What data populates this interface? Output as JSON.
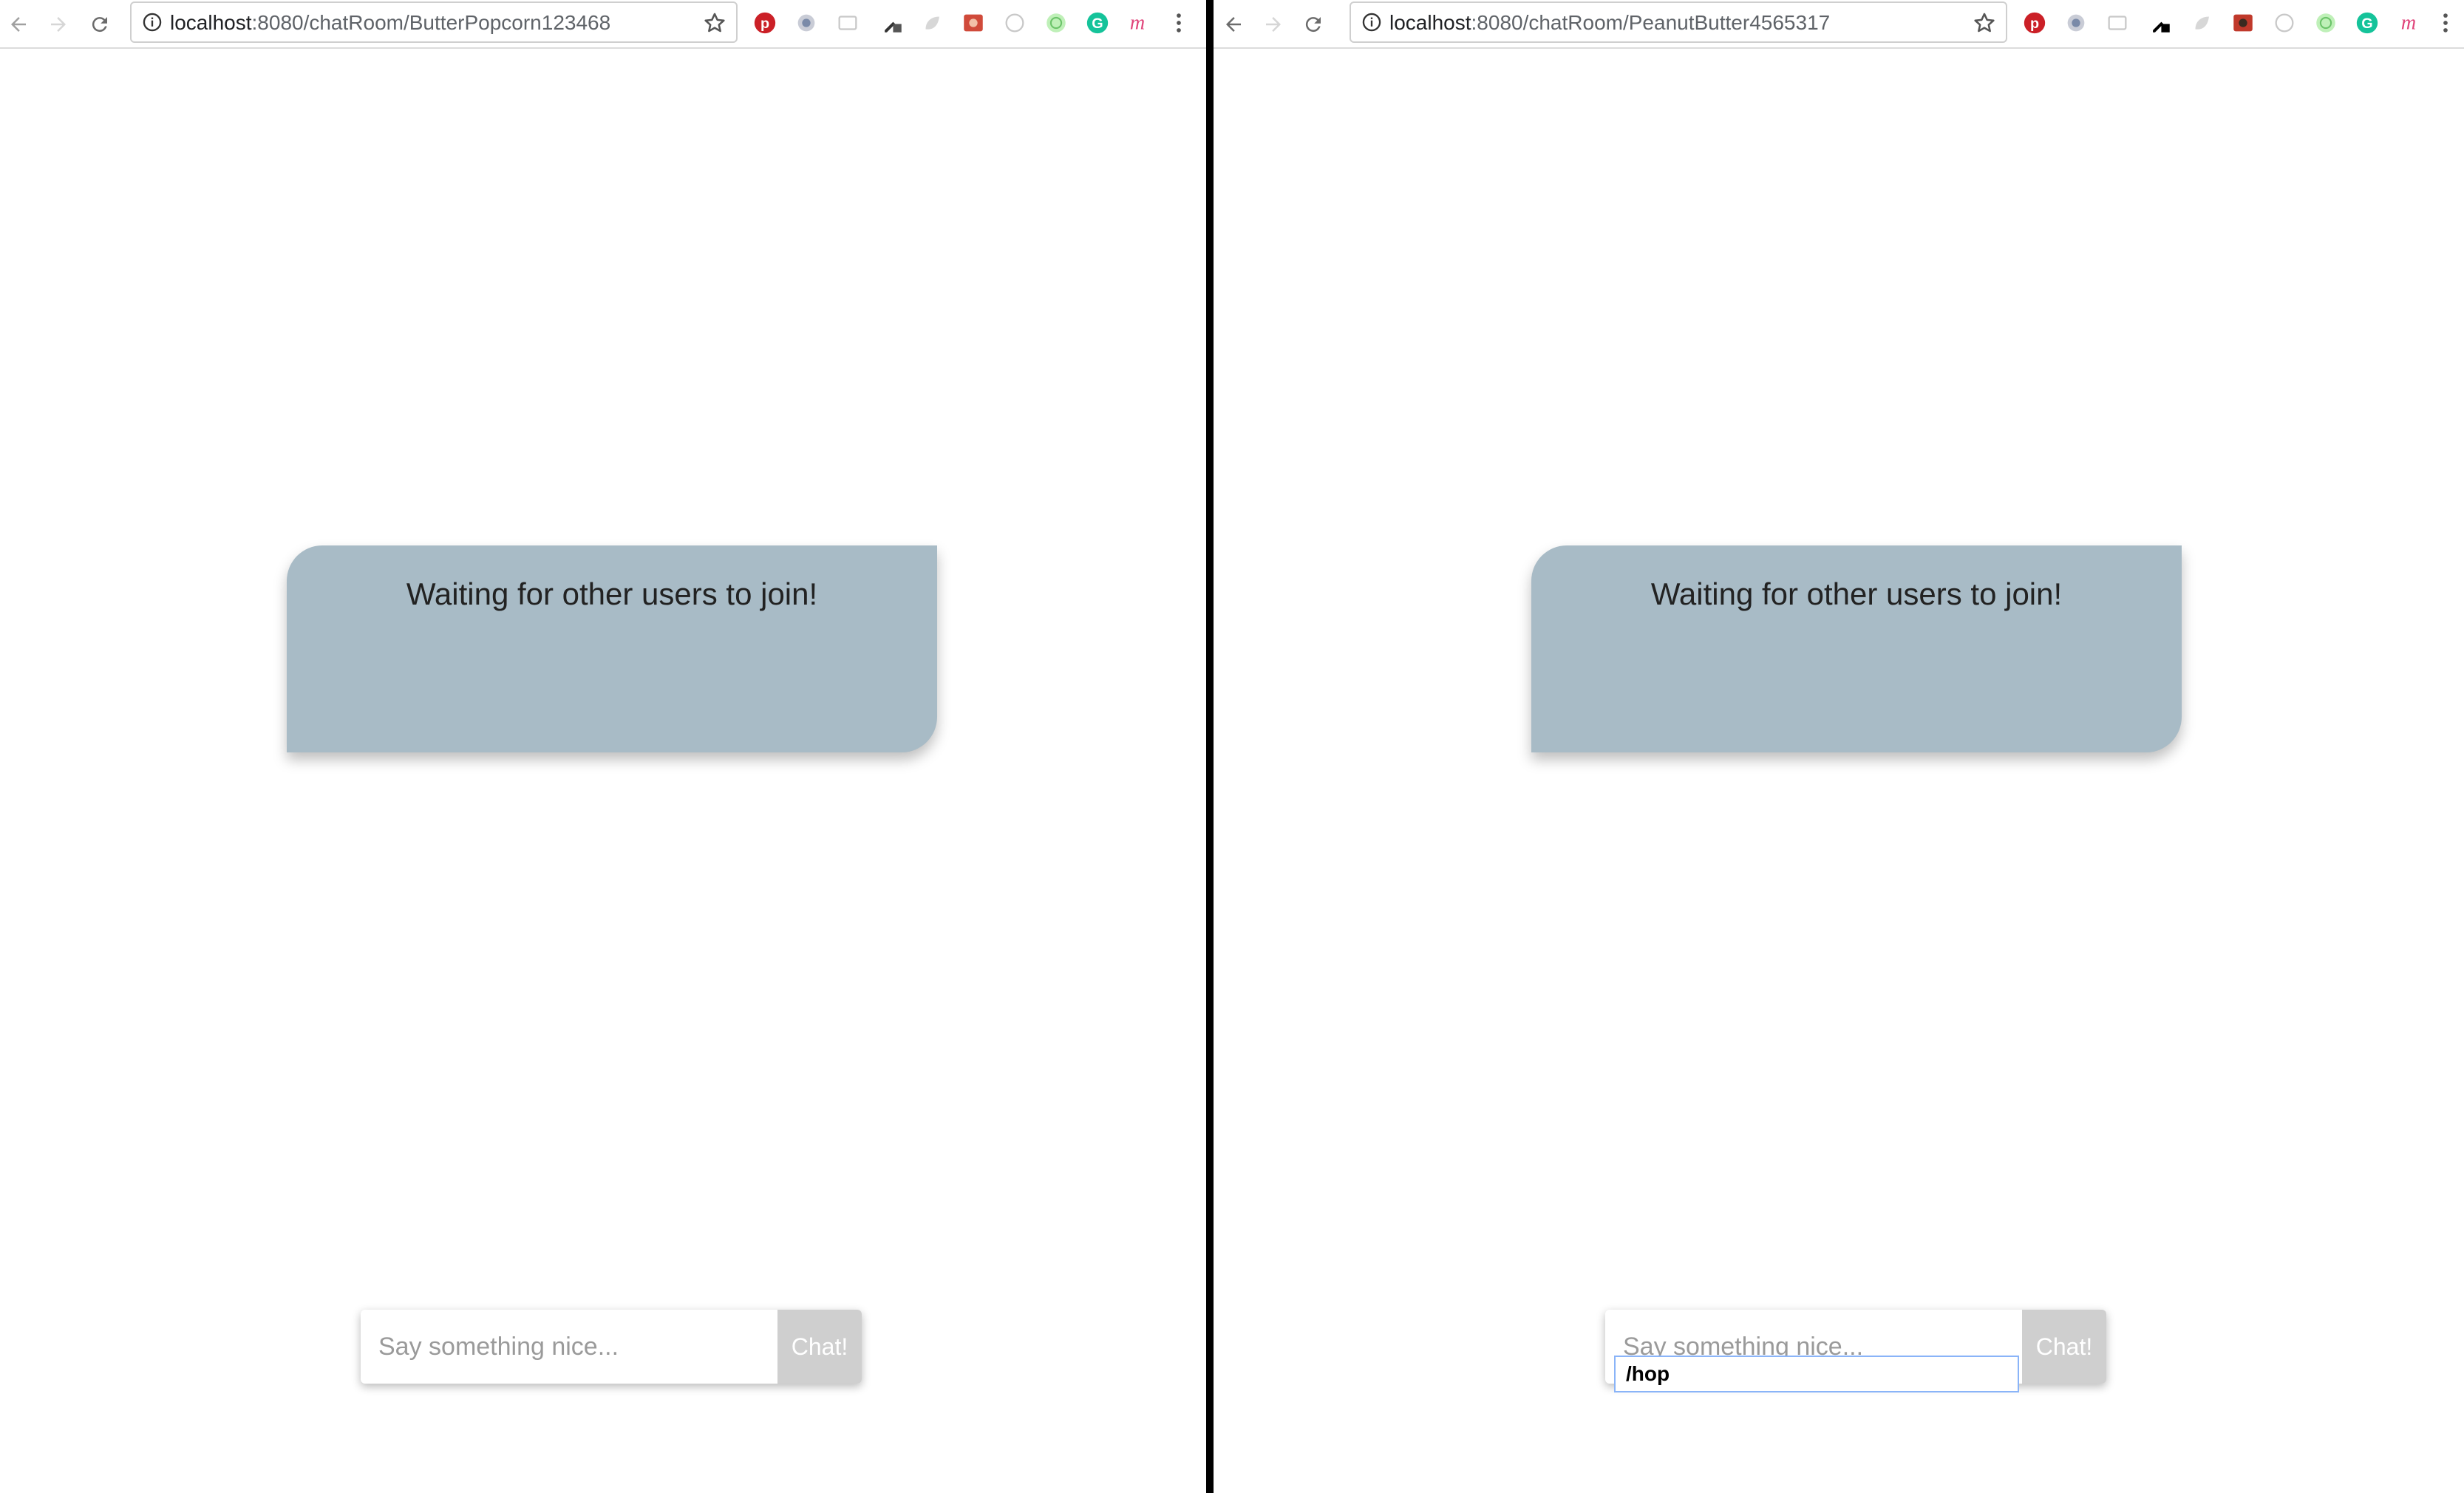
{
  "left": {
    "url_host": "localhost",
    "url_rest": ":8080/chatRoom/ButterPopcorn123468",
    "status_message": "Waiting for other users to join!",
    "chat_placeholder": "Say something nice...",
    "chat_button": "Chat!"
  },
  "right": {
    "url_host": "localhost",
    "url_rest": ":8080/chatRoom/PeanutButter4565317",
    "status_message": "Waiting for other users to join!",
    "chat_placeholder": "Say something nice...",
    "chat_button": "Chat!",
    "autocomplete_suggestion": "/hop"
  },
  "colors": {
    "card_background": "#a8bbc6",
    "chat_button_background": "#cfcfcf",
    "divider": "#000000"
  },
  "extension_icons": [
    "pinterest-icon",
    "eye-icon",
    "cast-icon",
    "eyedropper-icon",
    "leaf-icon",
    "photo-icon",
    "circle-icon",
    "smile-icon",
    "grammarly-icon",
    "m-icon"
  ]
}
